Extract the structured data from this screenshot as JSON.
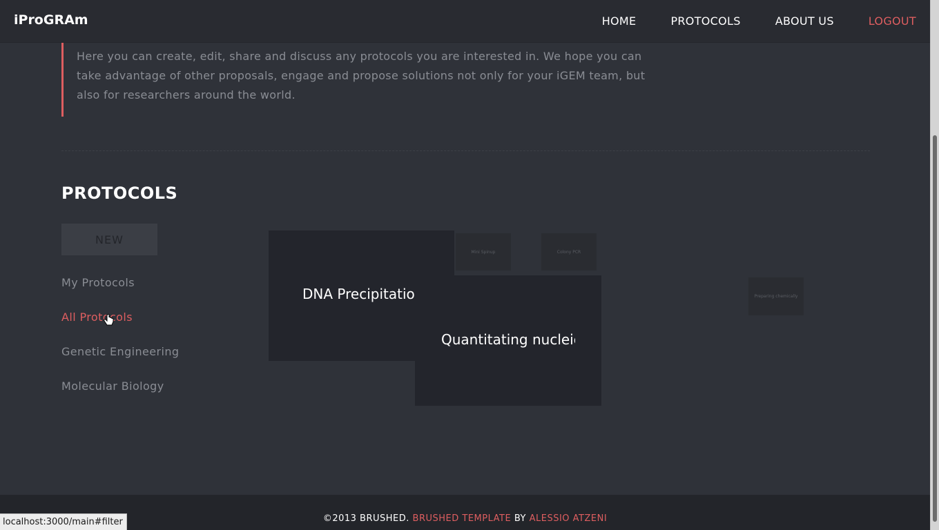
{
  "header": {
    "brand": "iProGRAm",
    "nav": [
      {
        "label": "HOME"
      },
      {
        "label": "PROTOCOLS"
      },
      {
        "label": "ABOUT US"
      },
      {
        "label": "LOGOUT"
      }
    ]
  },
  "intro": {
    "text": "Here you can create, edit, share and discuss any protocols you are interested in. We hope you can take advantage of other proposals, engage and propose solutions not only for your iGEM team, but also for researchers around the world."
  },
  "protocols": {
    "title": "PROTOCOLS",
    "new_label": "NEW",
    "filters": [
      {
        "label": "My Protocols",
        "active": false
      },
      {
        "label": "All Protocols",
        "active": true
      },
      {
        "label": "Genetic Engineering",
        "active": false
      },
      {
        "label": "Molecular Biology",
        "active": false
      }
    ],
    "tiles": {
      "large_1": "DNA Precipitation",
      "large_2": "Quantitating nucleic acids",
      "small_1": "Mini Spinup",
      "small_2": "Colony PCR",
      "small_3": "Preparing chemically"
    }
  },
  "footer": {
    "prefix": "©2013 BRUSHED.",
    "link1": "BRUSHED TEMPLATE",
    "by": "BY",
    "link2": "ALESSIO ATZENI"
  },
  "status_bar": {
    "url": "localhost:3000/main#filter"
  },
  "colors": {
    "accent": "#de5e60",
    "background": "#2f3239",
    "header": "#292b31"
  }
}
